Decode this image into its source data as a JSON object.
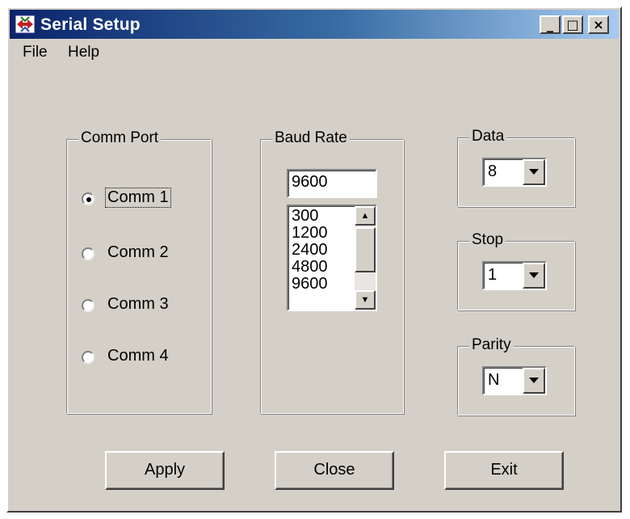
{
  "window": {
    "title": "Serial Setup",
    "icon": "serial-app-icon",
    "controls": {
      "minimize": "_",
      "maximize": "□",
      "close": "×"
    }
  },
  "menu": {
    "items": [
      "File",
      "Help"
    ]
  },
  "comm_port": {
    "label": "Comm Port",
    "options": [
      "Comm 1",
      "Comm 2",
      "Comm 3",
      "Comm 4"
    ],
    "selected": "Comm 1"
  },
  "baud_rate": {
    "label": "Baud Rate",
    "value": "9600",
    "list": [
      "300",
      "1200",
      "2400",
      "4800",
      "9600"
    ]
  },
  "data_bits": {
    "label": "Data",
    "value": "8"
  },
  "stop_bits": {
    "label": "Stop",
    "value": "1"
  },
  "parity": {
    "label": "Parity",
    "value": "N"
  },
  "buttons": {
    "apply": "Apply",
    "close": "Close",
    "exit": "Exit"
  },
  "colors": {
    "face": "#d4d0c8",
    "title_start": "#0a246a",
    "title_end": "#a6caf0"
  }
}
